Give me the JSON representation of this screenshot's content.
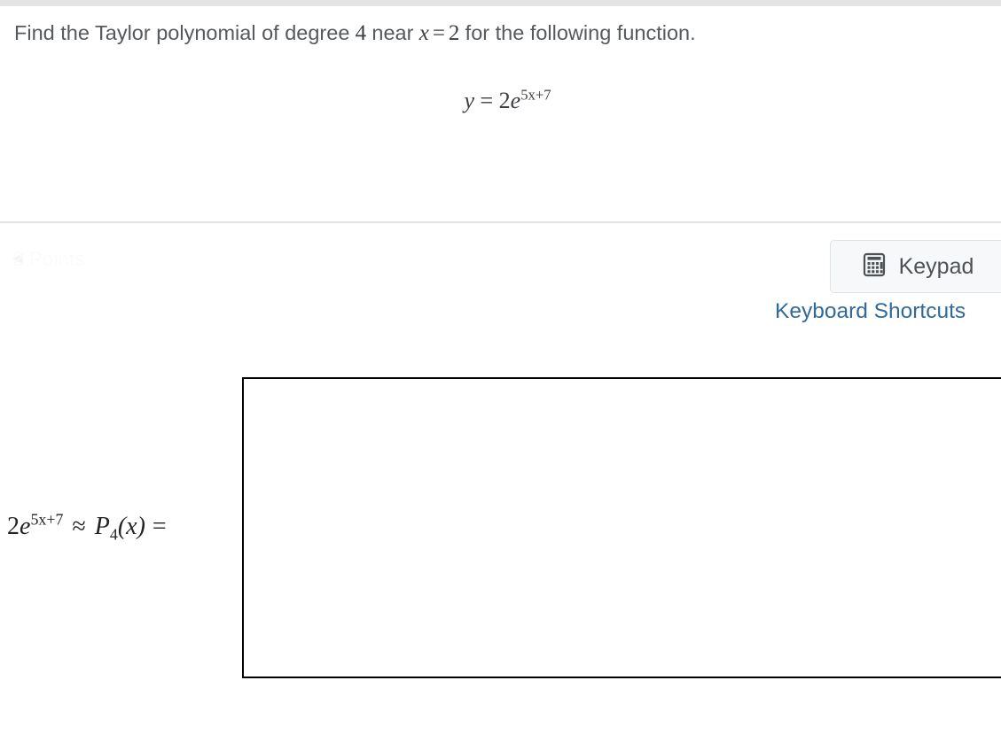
{
  "top_bar": {
    "present": true,
    "color": "#e4e4e4"
  },
  "question": {
    "lead": "Find the Taylor polynomial of degree",
    "degree": "4",
    "near_word": "near",
    "variable": "x",
    "equals": "=",
    "center": "2",
    "trail": "for the following function.",
    "text_color": "#555a5e"
  },
  "function_display": {
    "lhs": "y",
    "equals": "=",
    "coefficient": "2",
    "base": "e",
    "exponent": "5x+7",
    "plain": "y = 2e^(5x+7)"
  },
  "toolbar": {
    "points_label": "2 Points",
    "keypad_label": "Keypad",
    "keypad_icon": "calculator-icon",
    "keyboard_shortcuts_label": "Keyboard Shortcuts",
    "link_color": "#31699b"
  },
  "answer": {
    "prompt_coefficient": "2",
    "prompt_base": "e",
    "prompt_exponent": "5x+7",
    "approx_symbol": "≈",
    "polynomial": "P",
    "polynomial_degree": "4",
    "polynomial_arg": "(x)",
    "equals": "=",
    "plain": "2e^(5x+7) ≈ P4(x) =",
    "input_value": "",
    "input_placeholder": "",
    "border_color": "#000000"
  }
}
